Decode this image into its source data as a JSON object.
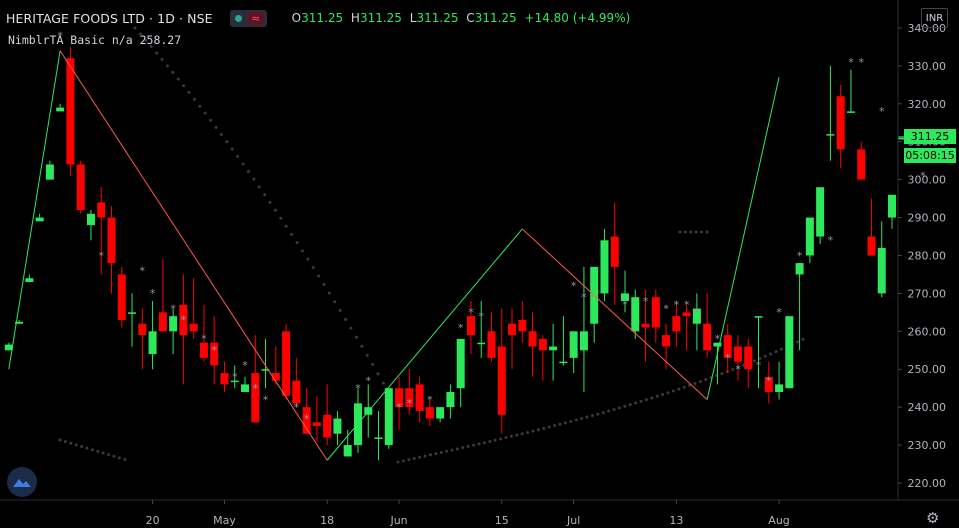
{
  "header": {
    "symbol_title": "HERITAGE FOODS LTD · 1D · NSE",
    "ohlc": [
      {
        "key": "O",
        "value": "311.25"
      },
      {
        "key": "H",
        "value": "311.25"
      },
      {
        "key": "L",
        "value": "311.25"
      },
      {
        "key": "C",
        "value": "311.25"
      }
    ],
    "change": "+14.80 (+4.99%)"
  },
  "indicator": {
    "name": "NimblrTA Basic",
    "value_na": "n/a",
    "value": "258.27"
  },
  "currency_button": "INR",
  "price_label": "311.25",
  "countdown_label": "05:08:15",
  "colors": {
    "up": "#2ee85c",
    "down": "#ff0000",
    "zigzag_up": "#2ee85c",
    "zigzag_down": "#ff5a4a",
    "background": "#000000"
  },
  "icons": [
    "eye-icon",
    "wave-icon",
    "logo-icon",
    "gear-icon"
  ],
  "chart_data": {
    "type": "candlestick",
    "y_axis": {
      "range": [
        214,
        343
      ],
      "ticks": [
        "220.00",
        "230.00",
        "240.00",
        "250.00",
        "260.00",
        "270.00",
        "280.00",
        "290.00",
        "300.00",
        "310.00",
        "320.00",
        "330.00",
        "340.00"
      ]
    },
    "x_labels": [
      "20",
      "May",
      "18",
      "Jun",
      "15",
      "Jul",
      "13",
      "Aug"
    ],
    "x_label_index": [
      14,
      21,
      31,
      38,
      48,
      55,
      65,
      75
    ],
    "candles": [
      [
        255,
        257,
        255,
        256.5
      ],
      [
        262,
        263,
        262,
        262.5
      ],
      [
        273,
        275,
        273,
        274
      ],
      [
        289,
        291,
        289,
        290
      ],
      [
        300,
        305,
        300,
        304
      ],
      [
        318,
        320,
        318,
        319
      ],
      [
        332,
        335,
        301,
        304
      ],
      [
        304,
        305,
        291,
        292
      ],
      [
        288,
        292,
        284,
        291
      ],
      [
        294,
        298,
        275,
        290
      ],
      [
        290,
        293,
        270,
        278
      ],
      [
        275,
        277,
        261,
        263
      ],
      [
        265,
        270,
        256,
        265
      ],
      [
        262,
        266,
        250,
        259
      ],
      [
        254,
        268,
        250,
        260
      ],
      [
        265,
        279,
        260,
        260
      ],
      [
        260,
        266,
        254,
        264
      ],
      [
        267,
        275,
        246,
        259
      ],
      [
        262,
        274,
        258,
        260
      ],
      [
        257,
        267,
        252,
        253
      ],
      [
        257,
        264,
        246,
        251
      ],
      [
        249,
        252,
        244,
        246
      ],
      [
        247,
        251,
        245,
        247
      ],
      [
        244,
        248,
        245,
        246
      ],
      [
        249,
        259,
        236,
        236
      ],
      [
        250,
        258,
        245,
        250
      ],
      [
        249,
        256,
        246,
        247
      ],
      [
        260,
        262,
        242,
        243
      ],
      [
        247,
        253,
        240,
        241
      ],
      [
        240,
        245,
        233,
        233
      ],
      [
        236,
        243,
        231,
        235
      ],
      [
        238,
        246,
        230,
        232
      ],
      [
        233,
        239,
        230,
        237
      ],
      [
        227,
        234,
        227,
        230
      ],
      [
        230,
        245,
        228,
        241
      ],
      [
        238,
        246,
        232,
        240
      ],
      [
        232,
        239,
        226,
        232
      ],
      [
        230,
        245,
        229,
        245
      ],
      [
        245,
        248,
        234,
        240
      ],
      [
        245,
        250,
        238,
        240
      ],
      [
        246,
        248,
        236,
        239
      ],
      [
        240,
        242,
        235,
        237
      ],
      [
        237,
        240,
        236,
        240
      ],
      [
        240,
        246,
        237,
        244
      ],
      [
        245,
        258,
        240,
        258
      ],
      [
        264,
        268,
        254,
        259
      ],
      [
        257,
        268,
        253,
        257
      ],
      [
        260,
        265,
        252,
        253
      ],
      [
        256,
        266,
        233,
        238
      ],
      [
        262,
        266,
        250,
        259
      ],
      [
        263,
        268,
        257,
        260
      ],
      [
        260,
        265,
        248,
        256
      ],
      [
        258,
        259,
        247,
        255
      ],
      [
        255,
        262,
        247,
        256
      ],
      [
        252,
        264,
        251,
        252
      ],
      [
        253,
        260,
        249,
        260
      ],
      [
        255,
        277,
        244,
        260
      ],
      [
        262,
        273,
        257,
        277
      ],
      [
        270,
        287,
        268,
        284
      ],
      [
        285,
        294,
        267,
        277
      ],
      [
        268,
        276,
        265,
        270
      ],
      [
        260,
        271,
        258,
        269
      ],
      [
        262,
        271,
        252,
        261
      ],
      [
        269,
        271,
        257,
        261
      ],
      [
        259,
        262,
        250,
        256
      ],
      [
        264,
        268,
        256,
        260
      ],
      [
        265,
        267,
        255,
        264
      ],
      [
        262,
        270,
        255,
        266
      ],
      [
        262,
        270,
        253,
        255
      ],
      [
        256,
        257,
        246,
        257
      ],
      [
        259,
        262,
        249,
        253
      ],
      [
        256,
        259,
        247,
        252
      ],
      [
        256,
        258,
        245,
        250
      ],
      [
        264,
        264,
        245,
        264
      ],
      [
        248,
        252,
        241,
        244
      ],
      [
        244,
        252,
        242,
        246
      ],
      [
        245,
        264,
        245,
        264
      ],
      [
        275,
        278,
        255,
        278
      ],
      [
        280,
        290,
        278,
        290
      ],
      [
        285,
        295,
        283,
        298
      ],
      [
        312,
        330,
        305,
        312
      ],
      [
        322,
        325,
        303,
        308
      ],
      [
        318,
        329,
        318,
        318
      ],
      [
        308,
        310,
        300,
        300
      ],
      [
        285,
        295,
        280,
        280
      ],
      [
        270,
        289,
        269,
        282
      ],
      [
        290,
        296,
        287,
        296
      ],
      [
        311,
        311,
        311,
        311
      ]
    ]
  }
}
